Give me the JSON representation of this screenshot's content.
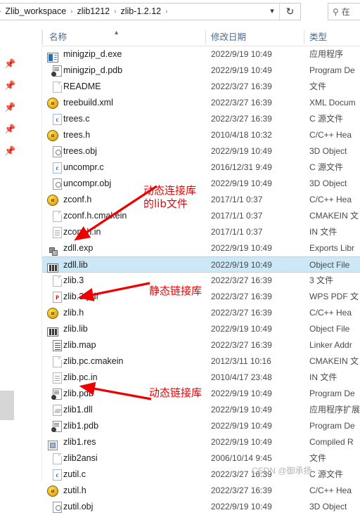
{
  "addressbar": {
    "crumbs": [
      "Zlib_workspace",
      "zlib1212",
      "zlib-1.2.12"
    ],
    "separator": "›",
    "leading_separator": "›",
    "caret_icon": "chevron-down-icon",
    "refresh_icon": "refresh-icon",
    "search": {
      "icon": "search-icon",
      "placeholder": "在"
    }
  },
  "columns": {
    "name": "名称",
    "date_modified": "修改日期",
    "type": "类型",
    "sort_indicator": "chevron-up-icon"
  },
  "navrail": {
    "pin_icon": "pin-icon",
    "pin_count": 5
  },
  "files": [
    {
      "name": "minigzip_d.exe",
      "date": "2022/9/19 10:49",
      "type": "应用程序",
      "icon": "exe",
      "selected": false
    },
    {
      "name": "minigzip_d.pdb",
      "date": "2022/9/19 10:49",
      "type": "Program De",
      "icon": "pdb",
      "selected": false
    },
    {
      "name": "README",
      "date": "2022/3/27 16:39",
      "type": "文件",
      "icon": "doc",
      "selected": false
    },
    {
      "name": "treebuild.xml",
      "date": "2022/3/27 16:39",
      "type": "XML Docum",
      "icon": "h",
      "selected": false
    },
    {
      "name": "trees.c",
      "date": "2022/3/27 16:39",
      "type": "C 源文件",
      "icon": "c",
      "selected": false
    },
    {
      "name": "trees.h",
      "date": "2010/4/18 10:32",
      "type": "C/C++ Hea",
      "icon": "h",
      "selected": false
    },
    {
      "name": "trees.obj",
      "date": "2022/9/19 10:49",
      "type": "3D Object",
      "icon": "obj",
      "selected": false
    },
    {
      "name": "uncompr.c",
      "date": "2016/12/31 9:49",
      "type": "C 源文件",
      "icon": "c",
      "selected": false
    },
    {
      "name": "uncompr.obj",
      "date": "2022/9/19 10:49",
      "type": "3D Object",
      "icon": "obj",
      "selected": false
    },
    {
      "name": "zconf.h",
      "date": "2017/1/1 0:37",
      "type": "C/C++ Hea",
      "icon": "h",
      "selected": false
    },
    {
      "name": "zconf.h.cmakein",
      "date": "2017/1/1 0:37",
      "type": "CMAKEIN 文",
      "icon": "doc",
      "selected": false
    },
    {
      "name": "zconf.h.in",
      "date": "2017/1/1 0:37",
      "type": "IN 文件",
      "icon": "doclines",
      "selected": false
    },
    {
      "name": "zdll.exp",
      "date": "2022/9/19 10:49",
      "type": "Exports Libr",
      "icon": "exp",
      "selected": false
    },
    {
      "name": "zdll.lib",
      "date": "2022/9/19 10:49",
      "type": "Object File",
      "icon": "lib",
      "selected": true
    },
    {
      "name": "zlib.3",
      "date": "2022/3/27 16:39",
      "type": "3 文件",
      "icon": "doc",
      "selected": false
    },
    {
      "name": "zlib.3.pdf",
      "date": "2022/3/27 16:39",
      "type": "WPS PDF 文",
      "icon": "pdf",
      "selected": false
    },
    {
      "name": "zlib.h",
      "date": "2022/3/27 16:39",
      "type": "C/C++ Hea",
      "icon": "h",
      "selected": false
    },
    {
      "name": "zlib.lib",
      "date": "2022/9/19 10:49",
      "type": "Object File",
      "icon": "lib",
      "selected": false
    },
    {
      "name": "zlib.map",
      "date": "2022/3/27 16:39",
      "type": "Linker Addr",
      "icon": "map",
      "selected": false
    },
    {
      "name": "zlib.pc.cmakein",
      "date": "2012/3/11 10:16",
      "type": "CMAKEIN 文",
      "icon": "doc",
      "selected": false
    },
    {
      "name": "zlib.pc.in",
      "date": "2010/4/17 23:48",
      "type": "IN 文件",
      "icon": "doclines",
      "selected": false
    },
    {
      "name": "zlib.pdb",
      "date": "2022/9/19 10:49",
      "type": "Program De",
      "icon": "pdb",
      "selected": false
    },
    {
      "name": "zlib1.dll",
      "date": "2022/9/19 10:49",
      "type": "应用程序扩展",
      "icon": "dll",
      "selected": false
    },
    {
      "name": "zlib1.pdb",
      "date": "2022/9/19 10:49",
      "type": "Program De",
      "icon": "pdb",
      "selected": false
    },
    {
      "name": "zlib1.res",
      "date": "2022/9/19 10:49",
      "type": "Compiled R",
      "icon": "res",
      "selected": false
    },
    {
      "name": "zlib2ansi",
      "date": "2006/10/14 9:45",
      "type": "文件",
      "icon": "doc",
      "selected": false
    },
    {
      "name": "zutil.c",
      "date": "2022/3/27 16:39",
      "type": "C 源文件",
      "icon": "c",
      "selected": false
    },
    {
      "name": "zutil.h",
      "date": "2022/3/27 16:39",
      "type": "C/C++ Hea",
      "icon": "h",
      "selected": false
    },
    {
      "name": "zutil.obj",
      "date": "2022/9/19 10:49",
      "type": "3D Object",
      "icon": "obj",
      "selected": false
    }
  ],
  "annotations": [
    {
      "text": "动态连接库\n的lib文件",
      "target": "zdll.lib"
    },
    {
      "text": "静态链接库",
      "target": "zlib.lib"
    },
    {
      "text": "动态链接库",
      "target": "zlib1.dll"
    }
  ],
  "watermark": "CSDN @御承扬",
  "colors": {
    "selection": "#cce8f7",
    "annotation": "#ee0000",
    "header_text": "#4a6a93"
  }
}
